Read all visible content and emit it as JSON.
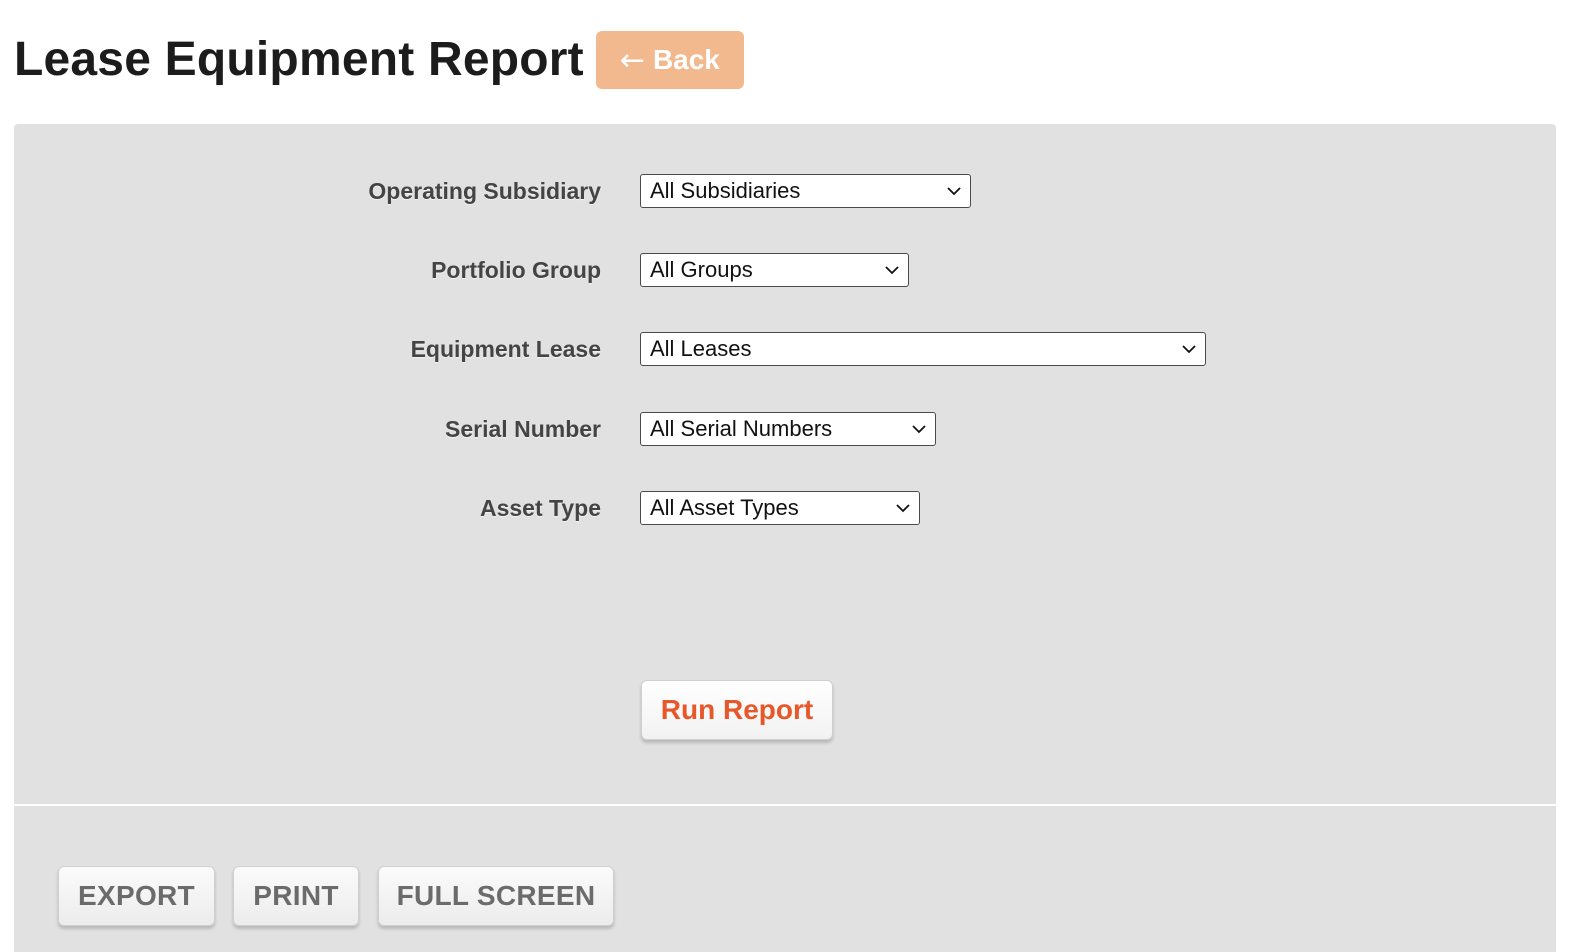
{
  "header": {
    "title": "Lease Equipment Report",
    "back_arrow": "←",
    "back_label": "Back",
    "back_color": "#f3b98e"
  },
  "filters": {
    "subsidiary": {
      "label": "Operating Subsidiary",
      "value": "All Subsidiaries"
    },
    "portfolio_group": {
      "label": "Portfolio Group",
      "value": "All Groups"
    },
    "equipment_lease": {
      "label": "Equipment Lease",
      "value": "All Leases"
    },
    "serial_number": {
      "label": "Serial Number",
      "value": "All Serial Numbers"
    },
    "asset_type": {
      "label": "Asset Type",
      "value": "All Asset Types"
    }
  },
  "actions": {
    "run_report_label": "Run Report",
    "run_report_color": "#e8572a"
  },
  "toolbar": {
    "export_label": "EXPORT",
    "print_label": "PRINT",
    "full_screen_label": "FULL SCREEN"
  },
  "icons": {
    "select_chevron": "chevron-down-icon"
  }
}
